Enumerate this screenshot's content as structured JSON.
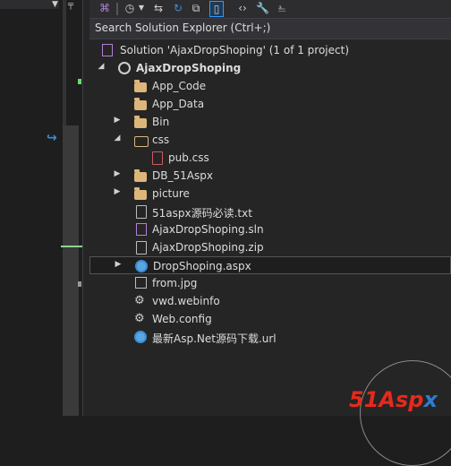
{
  "toolbar": {
    "icons": [
      "vs-icon",
      "history-icon",
      "dropdown-icon",
      "sync-icon",
      "refresh-icon",
      "collapse-icon",
      "show-all-files-icon",
      "code-icon",
      "properties-icon",
      "preview-icon"
    ]
  },
  "search": {
    "placeholder": "Search Solution Explorer (Ctrl+;)"
  },
  "tree": {
    "solution": "Solution 'AjaxDropShoping' (1 of 1 project)",
    "project": "AjaxDropShoping",
    "items": [
      {
        "label": "App_Code"
      },
      {
        "label": "App_Data"
      },
      {
        "label": "Bin"
      },
      {
        "label": "css"
      },
      {
        "label": "pub.css"
      },
      {
        "label": "DB_51Aspx"
      },
      {
        "label": "picture"
      },
      {
        "label": "51aspx源码必读.txt"
      },
      {
        "label": "AjaxDropShoping.sln"
      },
      {
        "label": "AjaxDropShoping.zip"
      },
      {
        "label": "DropShoping.aspx"
      },
      {
        "label": "from.jpg"
      },
      {
        "label": "vwd.webinfo"
      },
      {
        "label": "Web.config"
      },
      {
        "label": "最新Asp.Net源码下载.url"
      }
    ]
  },
  "watermark": {
    "brand": "51Asp",
    "brand_x": "x"
  },
  "colors": {
    "background": "#252526",
    "folder": "#dcb67a",
    "selection_border": "#545454",
    "accent": "#3399ff"
  }
}
